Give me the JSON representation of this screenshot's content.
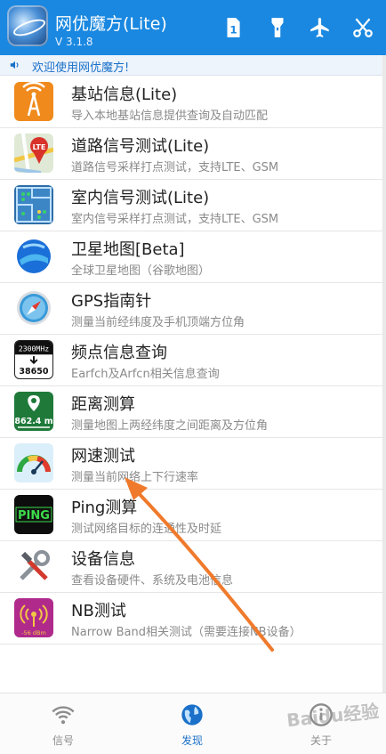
{
  "header": {
    "title": "网优魔方(Lite)",
    "version": "V 3.1.8",
    "buttons": [
      "sim-card-icon",
      "flashlight-icon",
      "airplane-icon",
      "scissors-icon"
    ]
  },
  "notice": {
    "text": "欢迎使用网优魔方!"
  },
  "items": [
    {
      "title": "基站信息(Lite)",
      "subtitle": "导入本地基站信息提供查询及自动匹配",
      "icon": "cell-tower-icon"
    },
    {
      "title": "道路信号测试(Lite)",
      "subtitle": "道路信号采样打点测试，支持LTE、GSM",
      "icon": "map-lte-icon"
    },
    {
      "title": "室内信号测试(Lite)",
      "subtitle": "室内信号采样打点测试，支持LTE、GSM",
      "icon": "floorplan-icon"
    },
    {
      "title": "卫星地图[Beta]",
      "subtitle": "全球卫星地图（谷歌地图）",
      "icon": "earth-icon"
    },
    {
      "title": "GPS指南针",
      "subtitle": "测量当前经纬度及手机顶端方位角",
      "icon": "compass-icon"
    },
    {
      "title": "频点信息查询",
      "subtitle": "Earfch及Arfcn相关信息查询",
      "icon": "frequency-icon",
      "icon_text_top": "2300MHz",
      "icon_text_bottom": "38650"
    },
    {
      "title": "距离测算",
      "subtitle": "测量地图上两经纬度之间距离及方位角",
      "icon": "distance-icon",
      "icon_text": "862.4 m"
    },
    {
      "title": "网速测试",
      "subtitle": "测量当前网络上下行速率",
      "icon": "speedometer-icon"
    },
    {
      "title": "Ping测算",
      "subtitle": "测试网络目标的连通性及时延",
      "icon": "ping-icon",
      "icon_text": "PING"
    },
    {
      "title": "设备信息",
      "subtitle": "查看设备硬件、系统及电池信息",
      "icon": "tools-icon"
    },
    {
      "title": "NB测试",
      "subtitle": "Narrow Band相关测试（需要连接NB设备）",
      "icon": "nb-signal-icon",
      "icon_text": "-56 dBm"
    }
  ],
  "tabs": [
    {
      "label": "信号",
      "icon": "signal-icon",
      "active": false
    },
    {
      "label": "发现",
      "icon": "globe-icon",
      "active": true
    },
    {
      "label": "关于",
      "icon": "info-icon",
      "active": false
    }
  ],
  "watermark": "Baidu经验",
  "colors": {
    "primary": "#1a88e0",
    "active_tab": "#1a70c8",
    "inactive_tab": "#8c8c8c",
    "arrow": "#f07a2c"
  }
}
